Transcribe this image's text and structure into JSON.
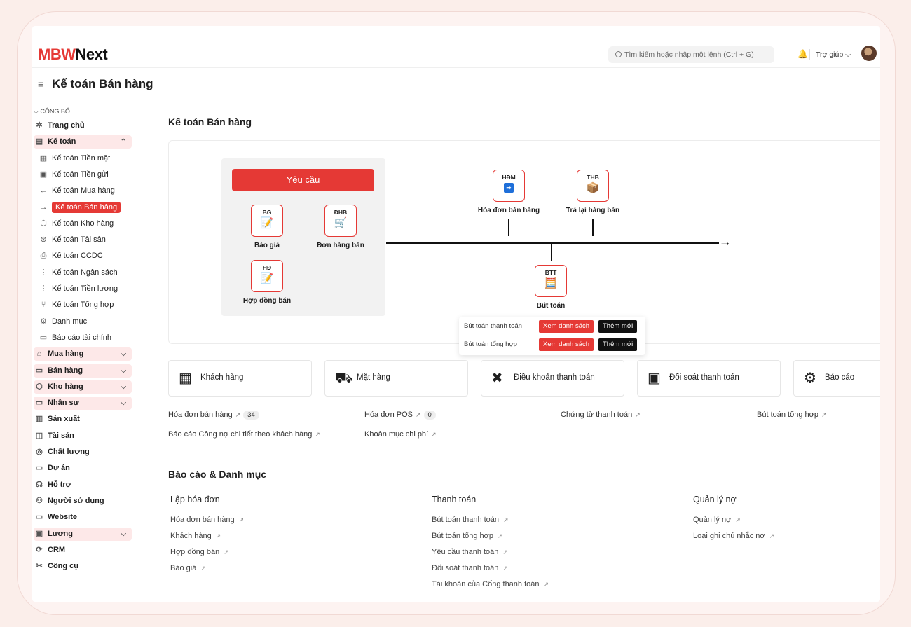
{
  "app": {
    "logo_mark": "MBW",
    "logo_name": "Next"
  },
  "header": {
    "search_placeholder": "Tìm kiếm hoặc nhập một lệnh (Ctrl + G)",
    "help_label": "Trợ giúp",
    "help_chevron": "⌵",
    "bell_glyph": "🔔"
  },
  "page": {
    "title": "Kế toán Bán hàng",
    "burger": "≡"
  },
  "sidebar": {
    "category": "CÔNG BỐ",
    "category_chevron": "⌵",
    "items": [
      {
        "label": "Trang chủ",
        "icon": "✲",
        "kind": "top"
      },
      {
        "label": "Kế toán",
        "icon": "▤",
        "kind": "top",
        "chev": "⌃",
        "highlight": true
      },
      {
        "label": "Kế toán Tiền mặt",
        "icon": "▦",
        "kind": "sub"
      },
      {
        "label": "Kế toán Tiền gửi",
        "icon": "▣",
        "kind": "sub"
      },
      {
        "label": "Kế toán Mua hàng",
        "icon": "←",
        "kind": "sub"
      },
      {
        "label": "Kế toán Bán hàng",
        "icon": "→",
        "kind": "sub",
        "active": true
      },
      {
        "label": "Kế toán Kho hàng",
        "icon": "⬡",
        "kind": "sub"
      },
      {
        "label": "Kế toán Tài sản",
        "icon": "⊛",
        "kind": "sub"
      },
      {
        "label": "Kế toán CCDC",
        "icon": "⎙",
        "kind": "sub"
      },
      {
        "label": "Kế toán Ngân sách",
        "icon": "⋮",
        "kind": "sub"
      },
      {
        "label": "Kế toán Tiền lương",
        "icon": "⋮",
        "kind": "sub"
      },
      {
        "label": "Kế toán Tổng hợp",
        "icon": "⑂",
        "kind": "sub"
      },
      {
        "label": "Danh mục",
        "icon": "⚙",
        "kind": "sub"
      },
      {
        "label": "Báo cáo tài chính",
        "icon": "▭",
        "kind": "sub"
      },
      {
        "label": "Mua hàng",
        "icon": "⌂",
        "kind": "top",
        "chev": "⌵",
        "highlight": true
      },
      {
        "label": "Bán hàng",
        "icon": "▭",
        "kind": "top",
        "chev": "⌵",
        "highlight": true
      },
      {
        "label": "Kho hàng",
        "icon": "⬡",
        "kind": "top",
        "chev": "⌵",
        "highlight": true
      },
      {
        "label": "Nhân sự",
        "icon": "▭",
        "kind": "top",
        "chev": "⌵",
        "highlight": true
      },
      {
        "label": "Sản xuất",
        "icon": "▥",
        "kind": "top"
      },
      {
        "label": "Tài sản",
        "icon": "◫",
        "kind": "top"
      },
      {
        "label": "Chất lượng",
        "icon": "◎",
        "kind": "top"
      },
      {
        "label": "Dự án",
        "icon": "▭",
        "kind": "top"
      },
      {
        "label": "Hỗ trợ",
        "icon": "☊",
        "kind": "top"
      },
      {
        "label": "Người sử dụng",
        "icon": "⚇",
        "kind": "top"
      },
      {
        "label": "Website",
        "icon": "▭",
        "kind": "top"
      },
      {
        "label": "Lương",
        "icon": "▣",
        "kind": "top",
        "chev": "⌵",
        "highlight": true
      },
      {
        "label": "CRM",
        "icon": "⟳",
        "kind": "top"
      },
      {
        "label": "Công cụ",
        "icon": "✂",
        "kind": "top"
      }
    ]
  },
  "main": {
    "title": "Kế toán Bán hàng",
    "flow": {
      "request_button": "Yêu cầu",
      "nodes": {
        "bg": {
          "code": "BG",
          "label": "Báo giá",
          "glyph": "📝"
        },
        "dhb": {
          "code": "ĐHB",
          "label": "Đơn hàng bán",
          "glyph": "🛒"
        },
        "hd": {
          "code": "HĐ",
          "label": "Hợp đồng bán",
          "glyph": "📝"
        },
        "hdm": {
          "code": "HĐM",
          "label": "Hóa đơn bán hàng",
          "glyph": "➡"
        },
        "thb": {
          "code": "THB",
          "label": "Trả lại hàng bán",
          "glyph": "📦"
        },
        "btt": {
          "code": "BTT",
          "label": "Bút toán",
          "glyph": "🧮"
        }
      },
      "arrow_glyph": "→",
      "popup": [
        {
          "label": "Bút toán thanh toán",
          "list_btn": "Xem danh sách",
          "new_btn": "Thêm mới"
        },
        {
          "label": "Bút toán tổng hợp",
          "list_btn": "Xem danh sách",
          "new_btn": "Thêm mới"
        }
      ]
    },
    "quick_cards": [
      {
        "label": "Khách hàng",
        "icon": "building-user-icon",
        "glyph": "▦"
      },
      {
        "label": "Mặt hàng",
        "icon": "truck-box-icon",
        "glyph": "⛟"
      },
      {
        "label": "Điều khoản thanh toán",
        "icon": "tools-icon",
        "glyph": "✖"
      },
      {
        "label": "Đối soát thanh toán",
        "icon": "money-bill-icon",
        "glyph": "▣"
      },
      {
        "label": "Báo cáo",
        "icon": "gear-icon",
        "glyph": "⚙"
      }
    ],
    "shortcuts": [
      {
        "label": "Hóa đơn bán hàng",
        "count": "34"
      },
      {
        "label": "Hóa đơn POS",
        "count": "0"
      },
      {
        "label": "Chứng từ thanh toán"
      },
      {
        "label": "Bút toán tổng hợp"
      },
      {
        "label": "Báo cáo Công nợ chi tiết theo khách hàng"
      },
      {
        "label": "Khoản mục chi phí"
      }
    ],
    "link_arrow": "↗",
    "reports": {
      "title": "Báo cáo & Danh mục",
      "columns": [
        {
          "heading": "Lập hóa đơn",
          "links": [
            "Hóa đơn bán hàng",
            "Khách hàng",
            "Hợp đồng bán",
            "Báo giá"
          ]
        },
        {
          "heading": "Thanh toán",
          "links": [
            "Bút toán thanh toán",
            "Bút toán tổng hợp",
            "Yêu cầu thanh toán",
            "Đối soát thanh toán",
            "Tài khoản của Cổng thanh toán"
          ]
        },
        {
          "heading": "Quản lý nợ",
          "links": [
            "Quản lý nợ",
            "Loại ghi chú nhắc nợ"
          ]
        }
      ]
    }
  },
  "colors": {
    "accent": "#e53935",
    "dark": "#111111",
    "soft_bg": "#fde8e8"
  }
}
